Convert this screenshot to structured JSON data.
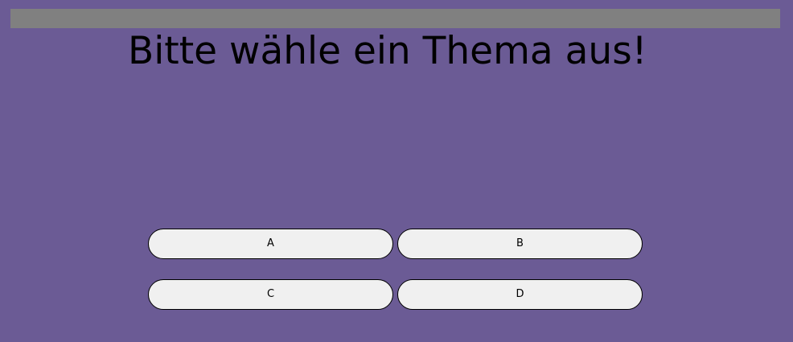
{
  "page": {
    "title": "Bitte wähle ein Thema aus!"
  },
  "colors": {
    "background": "#6b5b95",
    "top_bar": "#808080",
    "button_fill": "#f0f0f0",
    "text": "#000000"
  },
  "options": [
    {
      "label": "A"
    },
    {
      "label": "B"
    },
    {
      "label": "C"
    },
    {
      "label": "D"
    }
  ]
}
